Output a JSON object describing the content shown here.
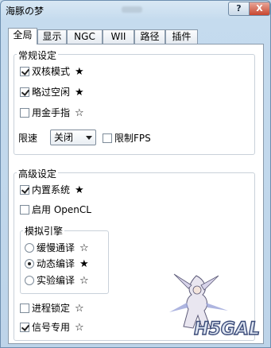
{
  "window": {
    "title": "海豚の梦",
    "help_label": "?",
    "close_label": "X"
  },
  "tabs": [
    {
      "label": "全局",
      "active": true
    },
    {
      "label": "显示"
    },
    {
      "label": "NGC"
    },
    {
      "label": "WII"
    },
    {
      "label": "路径"
    },
    {
      "label": "插件"
    }
  ],
  "general": {
    "title": "常规设定",
    "options": [
      {
        "label": "双核模式",
        "checked": true,
        "star": "★"
      },
      {
        "label": "略过空闲",
        "checked": true,
        "star": "★"
      },
      {
        "label": "用金手指",
        "checked": false,
        "star": "☆"
      }
    ],
    "speed_label": "限速",
    "speed_value": "关闭",
    "limit_fps_label": "限制FPS",
    "limit_fps_checked": false
  },
  "advanced": {
    "title": "高级设定",
    "options": [
      {
        "label": "内置系统",
        "checked": true,
        "star": "★"
      },
      {
        "label": "启用 OpenCL",
        "checked": false,
        "star": ""
      }
    ],
    "cpu_engine": {
      "title": "模拟引擎",
      "options": [
        {
          "label": "缓慢通译",
          "selected": false,
          "star": "☆"
        },
        {
          "label": "动态编译",
          "selected": true,
          "star": "★"
        },
        {
          "label": "实验编译",
          "selected": false,
          "star": "☆"
        }
      ]
    },
    "bottom_options": [
      {
        "label": "进程锁定",
        "checked": false,
        "star": "☆"
      },
      {
        "label": "信号专用",
        "checked": true,
        "star": "☆"
      }
    ]
  },
  "watermark": {
    "text": "H5GAL"
  }
}
